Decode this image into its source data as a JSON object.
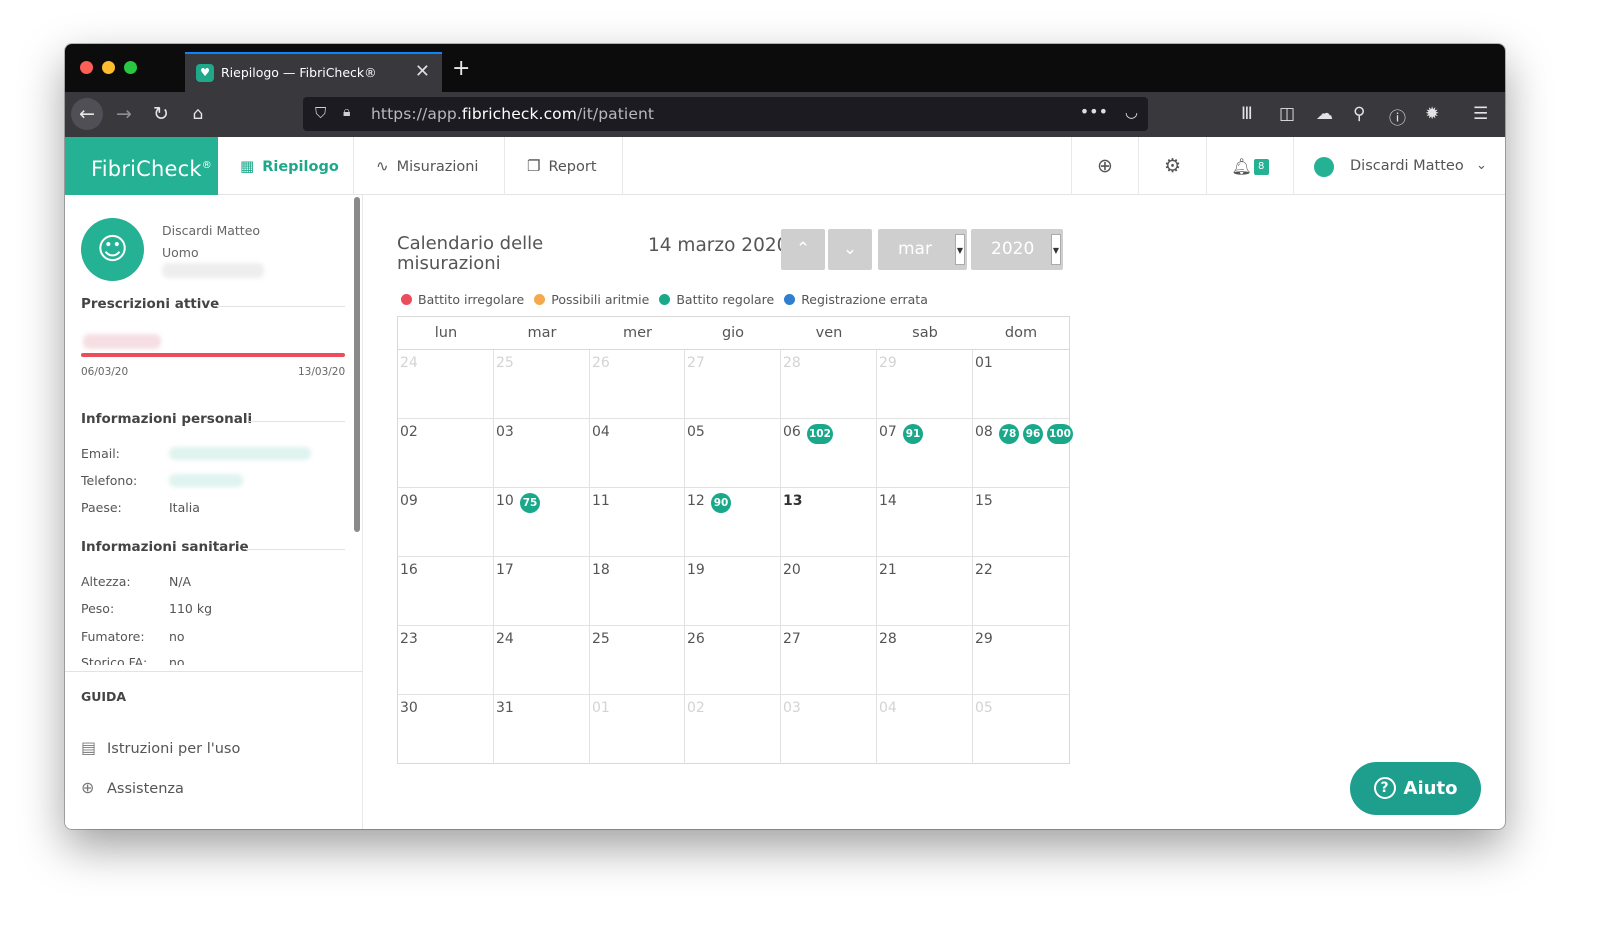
{
  "browser": {
    "tab_title": "Riepilogo — FibriCheck®",
    "tab_close": "✕",
    "new_tab": "+",
    "url_prefix": "https://app.",
    "url_domain": "fibricheck.com",
    "url_path": "/it/patient",
    "url_more": "•••",
    "colors": {
      "close": "#ff5f57",
      "minimize": "#febc2e",
      "zoom": "#28c840",
      "tab_accent": "#0a84ff"
    }
  },
  "app": {
    "brand": "FibriCheck",
    "brand_reg": "®",
    "accent": "#25b193",
    "nav": [
      {
        "label": "Riepilogo",
        "icon": "dashboard-icon"
      },
      {
        "label": "Misurazioni",
        "icon": "waveform-icon"
      },
      {
        "label": "Report",
        "icon": "report-icon"
      }
    ],
    "notification_count": "8",
    "user_name": "Discardi Matteo"
  },
  "patient": {
    "name": "Discardi Matteo",
    "gender": "Uomo",
    "prescriptions_title": "Prescrizioni attive",
    "prescription_start": "06/03/20",
    "prescription_end": "13/03/20",
    "personal_title": "Informazioni personali",
    "email_label": "Email:",
    "phone_label": "Telefono:",
    "country_label": "Paese:",
    "country_value": "Italia",
    "health_title": "Informazioni sanitarie",
    "height_label": "Altezza:",
    "height_value": "N/A",
    "weight_label": "Peso:",
    "weight_value": "110 kg",
    "smoker_label": "Fumatore:",
    "smoker_value": "no",
    "fa_label": "Storico FA:",
    "fa_value": "no"
  },
  "guide": {
    "title": "GUIDA",
    "instructions": "Istruzioni per l'uso",
    "support": "Assistenza"
  },
  "calendar": {
    "title": "Calendario delle misurazioni",
    "current_date": "14 marzo 2020",
    "month_select": "mar",
    "year_select": "2020",
    "legend": [
      {
        "label": "Battito irregolare",
        "color": "#ea4d5c"
      },
      {
        "label": "Possibili aritmie",
        "color": "#f5a94a"
      },
      {
        "label": "Battito regolare",
        "color": "#19a889"
      },
      {
        "label": "Registrazione errata",
        "color": "#2f7fd1"
      }
    ],
    "weekdays": [
      "lun",
      "mar",
      "mer",
      "gio",
      "ven",
      "sab",
      "dom"
    ],
    "weeks": [
      [
        {
          "d": "24",
          "o": true
        },
        {
          "d": "25",
          "o": true
        },
        {
          "d": "26",
          "o": true
        },
        {
          "d": "27",
          "o": true
        },
        {
          "d": "28",
          "o": true
        },
        {
          "d": "29",
          "o": true
        },
        {
          "d": "01"
        }
      ],
      [
        {
          "d": "02"
        },
        {
          "d": "03"
        },
        {
          "d": "04"
        },
        {
          "d": "05"
        },
        {
          "d": "06",
          "m": [
            "102"
          ]
        },
        {
          "d": "07",
          "m": [
            "91"
          ]
        },
        {
          "d": "08",
          "m": [
            "78",
            "96",
            "100"
          ]
        }
      ],
      [
        {
          "d": "09"
        },
        {
          "d": "10",
          "m": [
            "75"
          ]
        },
        {
          "d": "11"
        },
        {
          "d": "12",
          "m": [
            "90"
          ]
        },
        {
          "d": "13",
          "t": true
        },
        {
          "d": "14"
        },
        {
          "d": "15"
        }
      ],
      [
        {
          "d": "16"
        },
        {
          "d": "17"
        },
        {
          "d": "18"
        },
        {
          "d": "19"
        },
        {
          "d": "20"
        },
        {
          "d": "21"
        },
        {
          "d": "22"
        }
      ],
      [
        {
          "d": "23"
        },
        {
          "d": "24"
        },
        {
          "d": "25"
        },
        {
          "d": "26"
        },
        {
          "d": "27"
        },
        {
          "d": "28"
        },
        {
          "d": "29"
        }
      ],
      [
        {
          "d": "30"
        },
        {
          "d": "31"
        },
        {
          "d": "01",
          "o": true
        },
        {
          "d": "02",
          "o": true
        },
        {
          "d": "03",
          "o": true
        },
        {
          "d": "04",
          "o": true
        },
        {
          "d": "05",
          "o": true
        }
      ]
    ]
  },
  "help_button": "Aiuto"
}
